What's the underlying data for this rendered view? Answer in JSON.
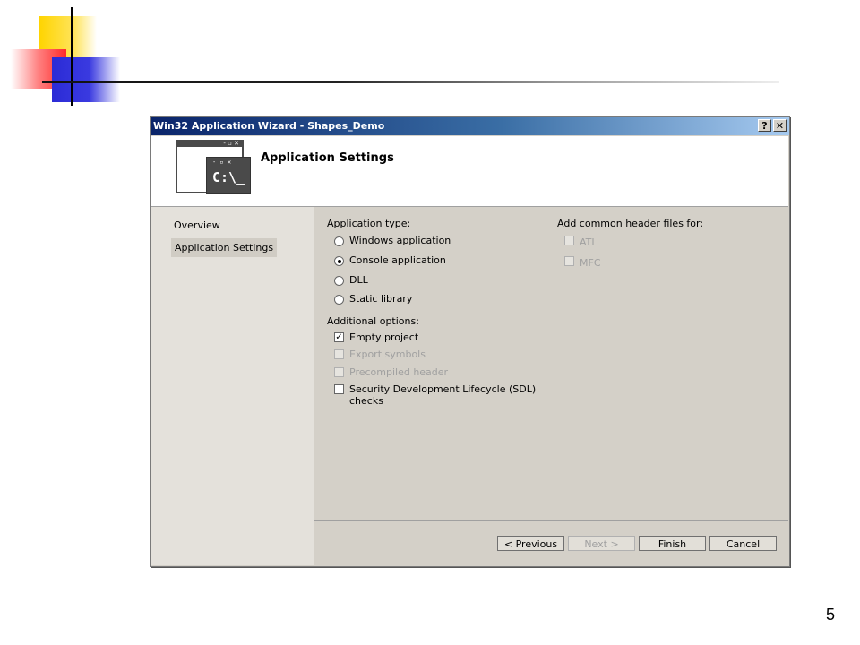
{
  "dialog": {
    "title": "Win32 Application Wizard - Shapes_Demo",
    "help_glyph": "?",
    "close_glyph": "✕",
    "header_title": "Application Settings",
    "header_console_glyph": "C:\\_"
  },
  "nav": {
    "items": [
      "Overview",
      "Application Settings"
    ],
    "selected": "Application Settings"
  },
  "app_type": {
    "label": "Application type:",
    "options": [
      "Windows application",
      "Console application",
      "DLL",
      "Static library"
    ],
    "selected": "Console application"
  },
  "additional": {
    "label": "Additional options:",
    "options": [
      {
        "label": "Empty project",
        "checked": true,
        "enabled": true
      },
      {
        "label": "Export symbols",
        "checked": false,
        "enabled": false
      },
      {
        "label": "Precompiled header",
        "checked": false,
        "enabled": false
      },
      {
        "label": "Security Development Lifecycle (SDL)",
        "label2": "checks",
        "checked": false,
        "enabled": true
      }
    ]
  },
  "headers": {
    "label": "Add common header files for:",
    "options": [
      {
        "label": "ATL",
        "checked": false,
        "enabled": false
      },
      {
        "label": "MFC",
        "checked": false,
        "enabled": false
      }
    ]
  },
  "buttons": {
    "previous": "< Previous",
    "next": "Next >",
    "finish": "Finish",
    "cancel": "Cancel"
  },
  "slide": {
    "page_number": "5"
  }
}
